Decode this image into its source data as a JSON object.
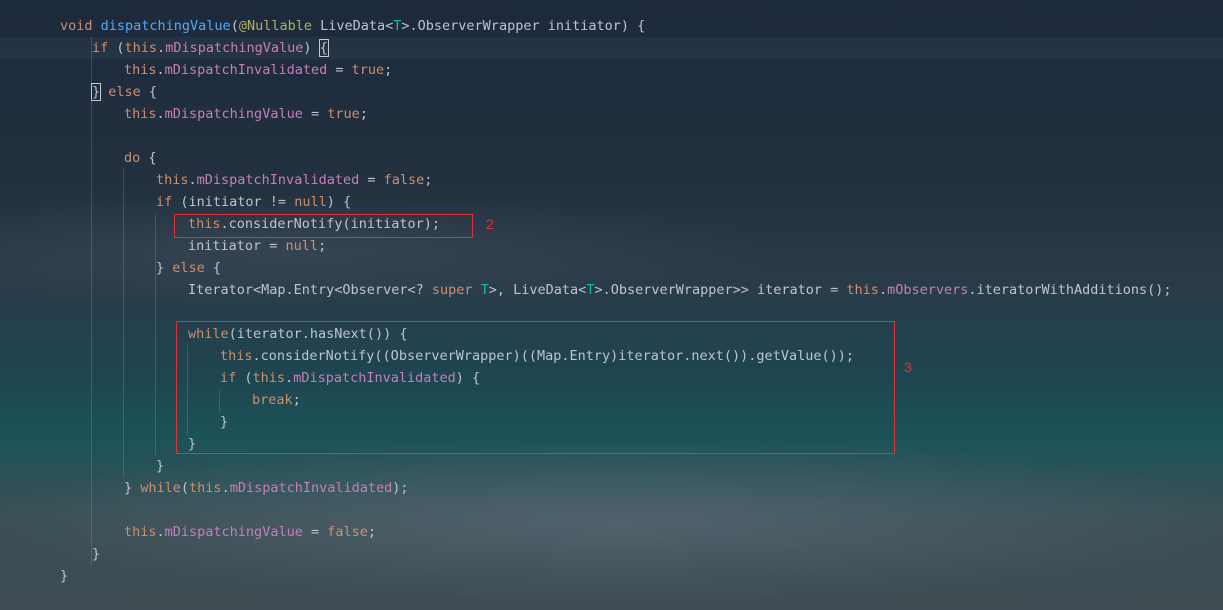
{
  "code": {
    "lines": [
      {
        "tokens": [
          {
            "c": "kw",
            "t": "void "
          },
          {
            "c": "fn",
            "t": "dispatchingValue"
          },
          {
            "c": "txt",
            "t": "("
          },
          {
            "c": "ann",
            "t": "@Nullable"
          },
          {
            "c": "txt",
            "t": " LiveData<"
          },
          {
            "c": "tp",
            "t": "T"
          },
          {
            "c": "txt",
            "t": ">.ObserverWrapper initiator) {"
          }
        ]
      },
      {
        "tokens": [
          {
            "c": "kw",
            "t": "if "
          },
          {
            "c": "txt",
            "t": "("
          },
          {
            "c": "kw",
            "t": "this"
          },
          {
            "c": "txt",
            "t": "."
          },
          {
            "c": "fld",
            "t": "mDispatchingValue"
          },
          {
            "c": "txt",
            "t": ") "
          },
          {
            "c": "txt hl",
            "t": "{"
          }
        ]
      },
      {
        "tokens": [
          {
            "c": "kw",
            "t": "this"
          },
          {
            "c": "txt",
            "t": "."
          },
          {
            "c": "fld",
            "t": "mDispatchInvalidated"
          },
          {
            "c": "txt",
            "t": " = "
          },
          {
            "c": "kw",
            "t": "true"
          },
          {
            "c": "txt",
            "t": ";"
          }
        ]
      },
      {
        "tokens": [
          {
            "c": "txt hl",
            "t": "}"
          },
          {
            "c": "kw",
            "t": " else"
          },
          {
            "c": "txt",
            "t": " {"
          }
        ]
      },
      {
        "tokens": [
          {
            "c": "kw",
            "t": "this"
          },
          {
            "c": "txt",
            "t": "."
          },
          {
            "c": "fld",
            "t": "mDispatchingValue"
          },
          {
            "c": "txt",
            "t": " = "
          },
          {
            "c": "kw",
            "t": "true"
          },
          {
            "c": "txt",
            "t": ";"
          }
        ]
      },
      {
        "tokens": []
      },
      {
        "tokens": [
          {
            "c": "kw",
            "t": "do"
          },
          {
            "c": "txt",
            "t": " {"
          }
        ]
      },
      {
        "tokens": [
          {
            "c": "kw",
            "t": "this"
          },
          {
            "c": "txt",
            "t": "."
          },
          {
            "c": "fld",
            "t": "mDispatchInvalidated"
          },
          {
            "c": "txt",
            "t": " = "
          },
          {
            "c": "kw",
            "t": "false"
          },
          {
            "c": "txt",
            "t": ";"
          }
        ]
      },
      {
        "tokens": [
          {
            "c": "kw",
            "t": "if"
          },
          {
            "c": "txt",
            "t": " (initiator != "
          },
          {
            "c": "kw",
            "t": "null"
          },
          {
            "c": "txt",
            "t": ") {"
          }
        ]
      },
      {
        "tokens": [
          {
            "c": "kw",
            "t": "this"
          },
          {
            "c": "txt",
            "t": "."
          },
          {
            "c": "txt",
            "t": "considerNotify(initiator);"
          }
        ]
      },
      {
        "tokens": [
          {
            "c": "txt",
            "t": "initiator = "
          },
          {
            "c": "kw",
            "t": "null"
          },
          {
            "c": "txt",
            "t": ";"
          }
        ]
      },
      {
        "tokens": [
          {
            "c": "txt",
            "t": "} "
          },
          {
            "c": "kw",
            "t": "else"
          },
          {
            "c": "txt",
            "t": " {"
          }
        ]
      },
      {
        "tokens": [
          {
            "c": "txt",
            "t": "Iterator<Map.Entry<Observer<? "
          },
          {
            "c": "kw",
            "t": "super"
          },
          {
            "c": "txt",
            "t": " "
          },
          {
            "c": "tp",
            "t": "T"
          },
          {
            "c": "txt",
            "t": ">, LiveData<"
          },
          {
            "c": "tp",
            "t": "T"
          },
          {
            "c": "txt",
            "t": ">.ObserverWrapper>> iterator = "
          },
          {
            "c": "kw",
            "t": "this"
          },
          {
            "c": "txt",
            "t": "."
          },
          {
            "c": "fld",
            "t": "mObservers"
          },
          {
            "c": "txt",
            "t": ".iteratorWithAdditions();"
          }
        ]
      },
      {
        "tokens": []
      },
      {
        "tokens": [
          {
            "c": "kw",
            "t": "while"
          },
          {
            "c": "txt",
            "t": "(iterator.hasNext()) {"
          }
        ]
      },
      {
        "tokens": [
          {
            "c": "kw",
            "t": "this"
          },
          {
            "c": "txt",
            "t": ".considerNotify((ObserverWrapper)((Map.Entry)iterator.next()).getValue());"
          }
        ]
      },
      {
        "tokens": [
          {
            "c": "kw",
            "t": "if"
          },
          {
            "c": "txt",
            "t": " ("
          },
          {
            "c": "kw",
            "t": "this"
          },
          {
            "c": "txt",
            "t": "."
          },
          {
            "c": "fld",
            "t": "mDispatchInvalidated"
          },
          {
            "c": "txt",
            "t": ") {"
          }
        ]
      },
      {
        "tokens": [
          {
            "c": "kw",
            "t": "break"
          },
          {
            "c": "txt",
            "t": ";"
          }
        ]
      },
      {
        "tokens": [
          {
            "c": "txt",
            "t": "}"
          }
        ]
      },
      {
        "tokens": [
          {
            "c": "txt",
            "t": "}"
          }
        ]
      },
      {
        "tokens": [
          {
            "c": "txt",
            "t": "}"
          }
        ]
      },
      {
        "tokens": [
          {
            "c": "txt",
            "t": "} "
          },
          {
            "c": "kw",
            "t": "while"
          },
          {
            "c": "txt",
            "t": "("
          },
          {
            "c": "kw",
            "t": "this"
          },
          {
            "c": "txt",
            "t": "."
          },
          {
            "c": "fld",
            "t": "mDispatchInvalidated"
          },
          {
            "c": "txt",
            "t": ");"
          }
        ]
      },
      {
        "tokens": []
      },
      {
        "tokens": [
          {
            "c": "kw",
            "t": "this"
          },
          {
            "c": "txt",
            "t": "."
          },
          {
            "c": "fld",
            "t": "mDispatchingValue"
          },
          {
            "c": "txt",
            "t": " = "
          },
          {
            "c": "kw",
            "t": "false"
          },
          {
            "c": "txt",
            "t": ";"
          }
        ]
      },
      {
        "tokens": [
          {
            "c": "txt",
            "t": "}"
          }
        ]
      },
      {
        "tokens": [
          {
            "c": "txt",
            "t": "}"
          }
        ]
      }
    ]
  },
  "annotations": {
    "box2_label": "2",
    "box3_label": "3",
    "color": "#e0303a"
  },
  "theme": {
    "keyword": "#cf8e6d",
    "method": "#56a8f5",
    "annotation": "#b3ae60",
    "field": "#c77dbb",
    "type_param": "#16baac",
    "text": "#bcc4d0"
  }
}
